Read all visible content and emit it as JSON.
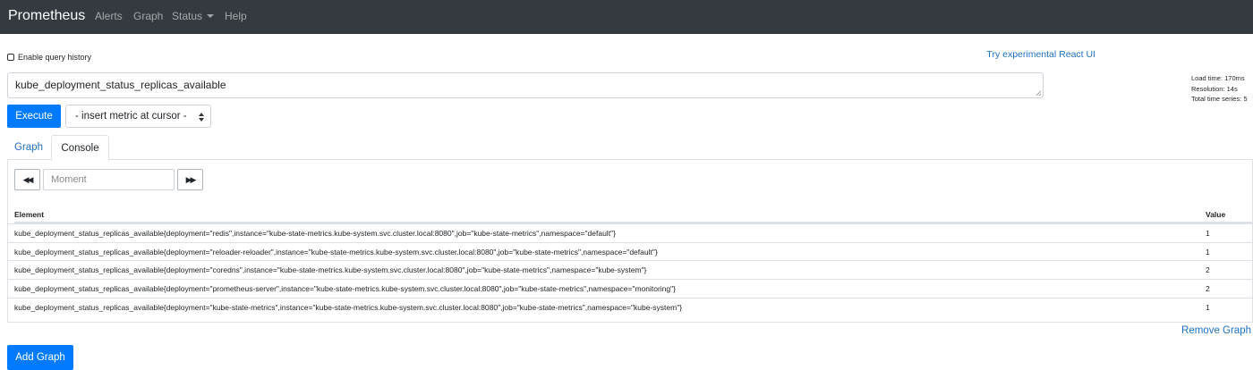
{
  "navbar": {
    "brand": "Prometheus",
    "links": [
      "Alerts",
      "Graph",
      "Status",
      "Help"
    ]
  },
  "history_label": "Enable query history",
  "react_link": "Try experimental React UI",
  "stats": {
    "load_time": "Load time: 170ms",
    "resolution": "Resolution: 14s",
    "total_series": "Total time series: 5"
  },
  "query": "kube_deployment_status_replicas_available",
  "execute_label": "Execute",
  "metric_select": "- insert metric at cursor -",
  "tabs": [
    "Graph",
    "Console"
  ],
  "moment_placeholder": "Moment",
  "table": {
    "headers": [
      "Element",
      "Value"
    ],
    "rows": [
      {
        "element": "kube_deployment_status_replicas_available{deployment=\"redis\",instance=\"kube-state-metrics.kube-system.svc.cluster.local:8080\",job=\"kube-state-metrics\",namespace=\"default\"}",
        "value": "1"
      },
      {
        "element": "kube_deployment_status_replicas_available{deployment=\"reloader-reloader\",instance=\"kube-state-metrics.kube-system.svc.cluster.local:8080\",job=\"kube-state-metrics\",namespace=\"default\"}",
        "value": "1"
      },
      {
        "element": "kube_deployment_status_replicas_available{deployment=\"coredns\",instance=\"kube-state-metrics.kube-system.svc.cluster.local:8080\",job=\"kube-state-metrics\",namespace=\"kube-system\"}",
        "value": "2"
      },
      {
        "element": "kube_deployment_status_replicas_available{deployment=\"prometheus-server\",instance=\"kube-state-metrics.kube-system.svc.cluster.local:8080\",job=\"kube-state-metrics\",namespace=\"monitoring\"}",
        "value": "2"
      },
      {
        "element": "kube_deployment_status_replicas_available{deployment=\"kube-state-metrics\",instance=\"kube-state-metrics.kube-system.svc.cluster.local:8080\",job=\"kube-state-metrics\",namespace=\"kube-system\"}",
        "value": "1"
      }
    ]
  },
  "remove_graph_label": "Remove Graph",
  "add_graph_label": "Add Graph",
  "icons": {
    "back": "double-chevron-left-icon",
    "forward": "double-chevron-right-icon",
    "status_caret": "caret-down-icon"
  },
  "colors": {
    "navbar": "#343a40",
    "primary": "#007bff",
    "link": "#1f70c1"
  }
}
